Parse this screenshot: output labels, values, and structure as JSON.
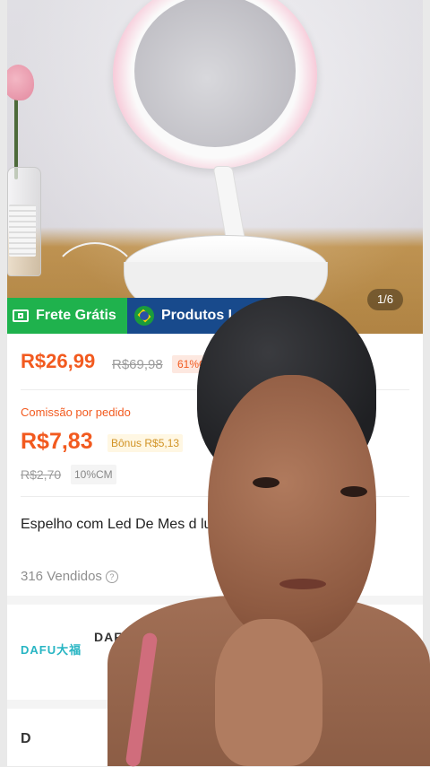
{
  "hero": {
    "image_counter": "1/6"
  },
  "badges": {
    "free_shipping": "Frete Grátis",
    "brand_products": "Produtos L"
  },
  "pricing": {
    "current": "R$26,99",
    "original": "R$69,98",
    "discount": "61%OF",
    "commission_label": "Comissão por pedido",
    "commission_value": "R$7,83",
    "bonus": "Bônus R$5,13",
    "commission_old": "R$2,70",
    "commission_rate": "10%CM"
  },
  "product": {
    "title": "Espelho com Led De Mes                                      d luz Dobravel Para Maquia",
    "sold": "316 Vendidos"
  },
  "store": {
    "logo_text": "DAFU大福",
    "name": "DAFUSH"
  },
  "bottom": {
    "letter": "D"
  },
  "colors": {
    "accent_orange": "#f25a1f",
    "green_badge": "#1fb24d",
    "blue_badge": "#184a8c"
  }
}
